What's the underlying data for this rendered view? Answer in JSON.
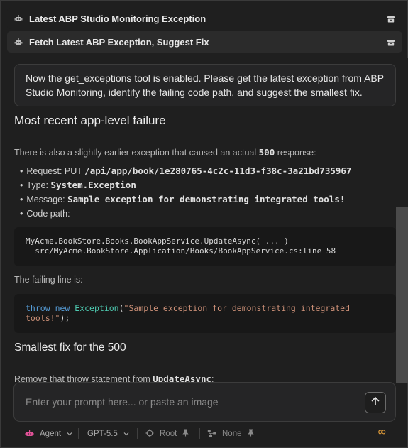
{
  "sessions": [
    {
      "title": "Latest ABP Studio Monitoring Exception",
      "icon": "bot-icon",
      "action_icon": "archive-icon"
    },
    {
      "title": "Fetch Latest ABP Exception, Suggest Fix",
      "icon": "bot-icon",
      "action_icon": "archive-icon"
    }
  ],
  "user_message": "Now the get_exceptions tool is enabled. Please get the latest exception from ABP Studio Monitoring, identify the failing code path, and suggest the smallest fix.",
  "response": {
    "heading1": "Most recent app-level failure",
    "intro_prefix": "There is also a slightly earlier exception that caused an actual ",
    "intro_code": "500",
    "intro_suffix": " response:",
    "request_label": "Request: ",
    "request_method": "PUT",
    "request_path": "/api/app/book/1e280765-4c2c-11d3-f38c-3a21bd735967",
    "type_label": "Type: ",
    "type_value": "System.Exception",
    "message_label": "Message: ",
    "message_value": "Sample exception for demonstrating integrated tools!",
    "codepath_label": "Code path:",
    "codepath_line1": "MyAcme.BookStore.Books.BookAppService.UpdateAsync( ... )",
    "codepath_line2": "  src/MyAcme.BookStore.Application/Books/BookAppService.cs:line 58",
    "failing_line_label": "The failing line is:",
    "code_throw": "throw",
    "code_new": "new",
    "code_type": "Exception",
    "code_string": "\"Sample exception for demonstrating integrated",
    "code_string2": "tools!\"",
    "code_end": ");",
    "heading2": "Smallest fix for the 500",
    "fix_prefix": "Remove that throw statement from ",
    "fix_code": "UpdateAsync",
    "fix_suffix": ":"
  },
  "prompt": {
    "placeholder": "Enter your prompt here... or paste an image"
  },
  "toolbar": {
    "mode": "Agent",
    "model": "GPT-5.5",
    "root": "Root",
    "none": "None",
    "infinity": "∞"
  },
  "colors": {
    "accent_agent": "#e05297",
    "infinity": "#e8a13a",
    "keyword": "#569cd6",
    "type": "#4ec9b0",
    "string": "#ce9178"
  }
}
